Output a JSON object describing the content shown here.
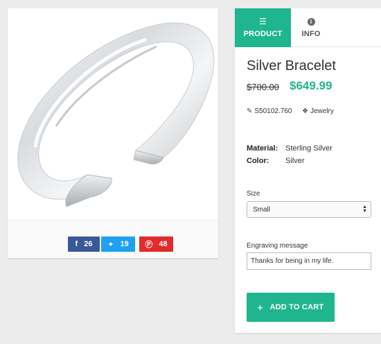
{
  "product": {
    "image_alt": "Silver Bracelet image",
    "title": "Silver Bracelet",
    "price_old": "$700.00",
    "price_new": "$649.99",
    "sku": "S50102.760",
    "category": "Jewelry"
  },
  "share": {
    "facebook": {
      "icon": "f",
      "count": "26"
    },
    "twitter": {
      "icon": "twitter-bird",
      "count": "19"
    },
    "pinterest": {
      "icon": "pinterest",
      "count": "48"
    }
  },
  "tabs": [
    {
      "label": "PRODUCT",
      "icon": "bars-icon",
      "active": true
    },
    {
      "label": "INFO",
      "icon": "info-icon",
      "active": false
    }
  ],
  "specs": [
    {
      "key": "Material:",
      "value": "Sterling Silver"
    },
    {
      "key": "Color:",
      "value": "Silver"
    }
  ],
  "form": {
    "size_label": "Size",
    "size_value": "Small",
    "engraving_label": "Engraving message",
    "engraving_value": "Thanks for being in my life."
  },
  "cart": {
    "label": "ADD TO CART"
  },
  "colors": {
    "accent": "#1fb58f",
    "facebook": "#3b5998",
    "twitter": "#1da1f2",
    "pinterest": "#e12b2c"
  }
}
